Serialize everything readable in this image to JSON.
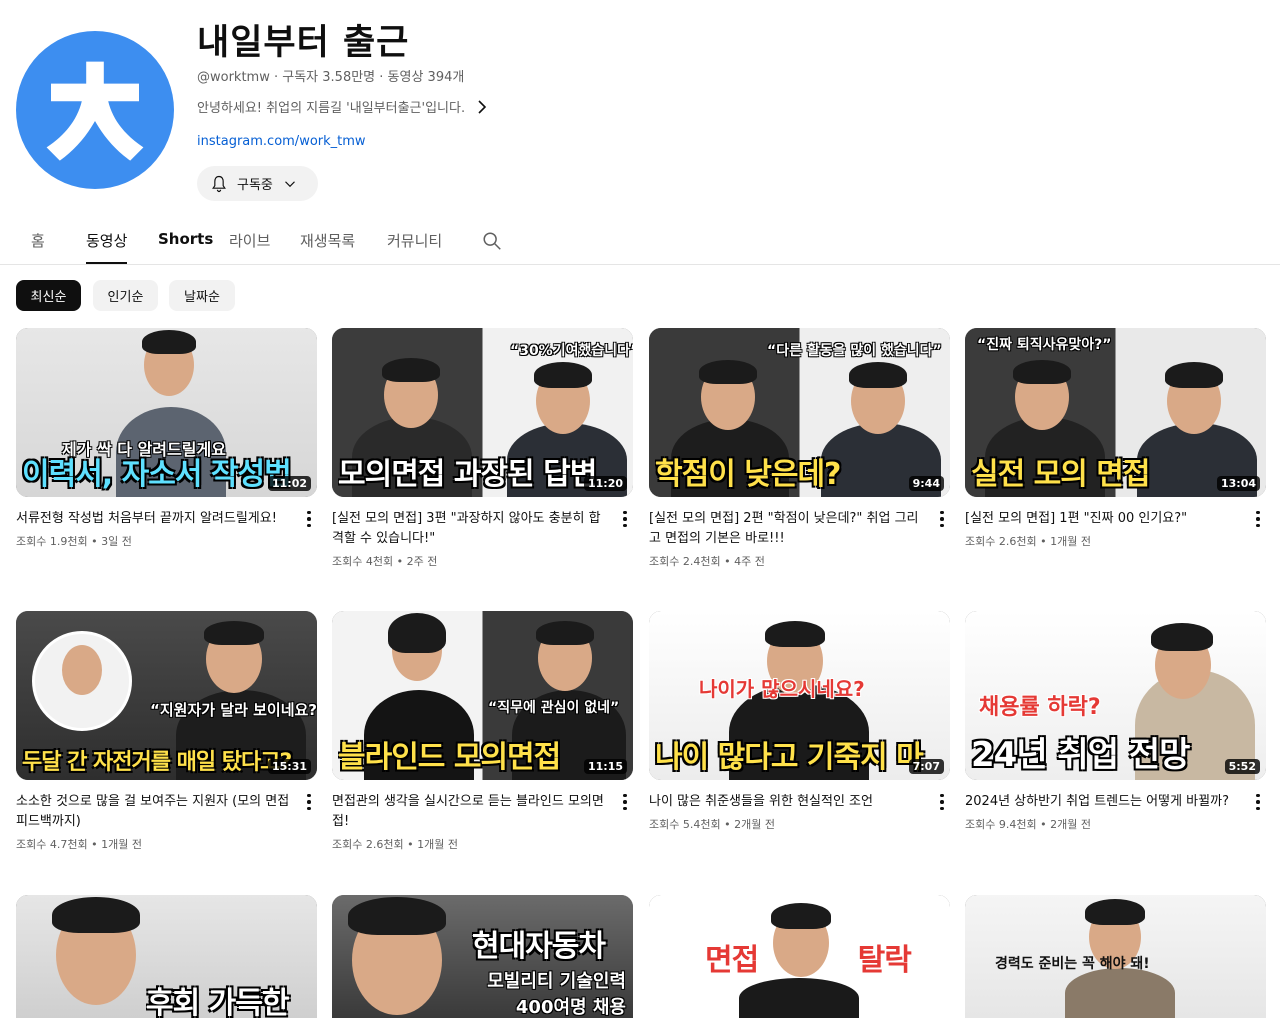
{
  "channel": {
    "name": "내일부터 출근",
    "handle": "@worktmw",
    "meta_rest": " · 구독자 3.58만명 · 동영상 394개",
    "description": "안녕하세요! 취업의 지름길 '내일부터출근'입니다.",
    "link": "instagram.com/work_tmw",
    "subscribe_label": "구독중",
    "avatar_color": "#3d8ef0"
  },
  "tabs": [
    {
      "label": "홈"
    },
    {
      "label": "동영상"
    },
    {
      "label": "Shorts"
    },
    {
      "label": "라이브"
    },
    {
      "label": "재생목록"
    },
    {
      "label": "커뮤니티"
    }
  ],
  "chips": [
    {
      "label": "최신순"
    },
    {
      "label": "인기순"
    },
    {
      "label": "날짜순"
    }
  ],
  "videos": [
    {
      "title": "서류전형 작성법 처음부터 끝까지 알려드릴게요!",
      "views": "조회수 1.9천회",
      "age": "3일 전",
      "duration": "11:02",
      "thumb_small": "제가 싹 다 알려드릴게요",
      "thumb_big": "이력서, 자소서 작성법"
    },
    {
      "title": "[실전 모의 면접] 3편 \"과장하지 않아도 충분히 합격할 수 있습니다!\"",
      "views": "조회수 4천회",
      "age": "2주 전",
      "duration": "11:20",
      "thumb_small": "“30%기여했습니다”",
      "thumb_big": "모의면접 과장된 답변"
    },
    {
      "title": "[실전 모의 면접] 2편 \"학점이 낮은데?\" 취업 그리고 면접의 기본은 바로!!!",
      "views": "조회수 2.4천회",
      "age": "4주 전",
      "duration": "9:44",
      "thumb_small": "“다른 활동을 많이 했습니다”",
      "thumb_big": "학점이 낮은데?"
    },
    {
      "title": "[실전 모의 면접] 1편 \"진짜 00 인기요?\"",
      "views": "조회수 2.6천회",
      "age": "1개월 전",
      "duration": "13:04",
      "thumb_small": "“진짜 퇴직사유맞아?”",
      "thumb_big": "실전 모의 면접"
    },
    {
      "title": "소소한 것으로 많을 걸 보여주는 지원자 (모의 면접 피드백까지)",
      "views": "조회수 4.7천회",
      "age": "1개월 전",
      "duration": "15:31",
      "thumb_small": "“지원자가 달라 보이네요?”",
      "thumb_big": "두달 간 자전거를 매일 탔다고?"
    },
    {
      "title": "면접관의 생각을 실시간으로 듣는 블라인드 모의면접!",
      "views": "조회수 2.6천회",
      "age": "1개월 전",
      "duration": "11:15",
      "thumb_small": "“직무에 관심이 없네”",
      "thumb_big": "블라인드 모의면접"
    },
    {
      "title": "나이 많은 취준생들을 위한 현실적인 조언",
      "views": "조회수 5.4천회",
      "age": "2개월 전",
      "duration": "7:07",
      "thumb_small": "나이가        많으시네요?",
      "thumb_big": "나이 많다고 기죽지 마"
    },
    {
      "title": "2024년 상하반기 취업 트렌드는 어떻게 바뀔까?",
      "views": "조회수 9.4천회",
      "age": "2개월 전",
      "duration": "5:52",
      "thumb_small": "채용률 하락?",
      "thumb_big": "24년 취업 전망"
    },
    {
      "title": "",
      "views": "",
      "age": "",
      "duration": "",
      "thumb_small": "",
      "thumb_big": "후회 가득한"
    },
    {
      "title": "",
      "views": "",
      "age": "",
      "duration": "",
      "thumb_small": "모빌리티 기술인력 400여명 채용",
      "thumb_big": "현대자동차"
    },
    {
      "title": "",
      "views": "",
      "age": "",
      "duration": "",
      "thumb_small": "",
      "thumb_big": "면접 탈락"
    },
    {
      "title": "",
      "views": "",
      "age": "",
      "duration": "",
      "thumb_small": "경력도 준비는        꼭 해야 돼!",
      "thumb_big": ""
    }
  ]
}
